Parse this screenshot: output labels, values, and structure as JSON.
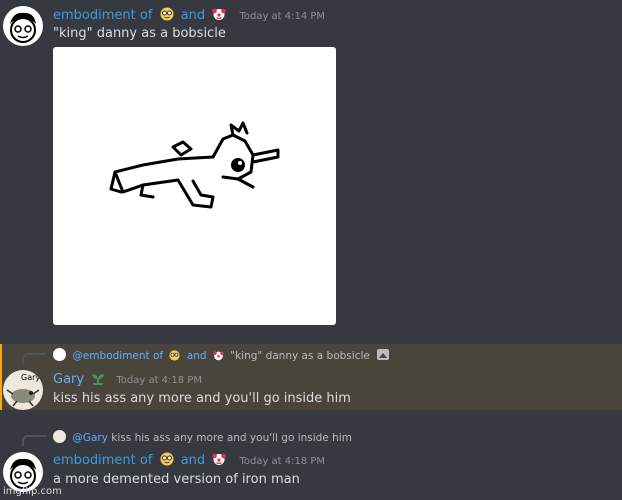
{
  "messages": [
    {
      "author": "embodiment of",
      "and": "and",
      "timestamp": "Today at 4:14 PM",
      "text": "\"king\" danny as a bobsicle",
      "attachment": "drawing"
    },
    {
      "reply": {
        "author": "@embodiment of",
        "and": "and",
        "text": "\"king\" danny as a bobsicle"
      },
      "author": "Gary",
      "timestamp": "Today at 4:18 PM",
      "text": "kiss his ass any more and you'll go inside him",
      "highlighted": true
    },
    {
      "reply": {
        "author": "@Gary",
        "text": "kiss his ass any more and you'll go inside him"
      },
      "author": "embodiment of",
      "and": "and",
      "timestamp": "Today at 4:18 PM",
      "text": "a more demented version of iron man"
    }
  ],
  "icons": {
    "emoji_1": "nerd-face-emoji",
    "emoji_2": "clown-face-emoji",
    "gary_badge": "seedling-icon",
    "reply_attachment": "image-icon"
  },
  "colors": {
    "background": "#36393f",
    "username": "#3d9be0",
    "highlight": "#49443c",
    "timestamp": "#8e9297"
  },
  "watermark": "imgflip.com"
}
